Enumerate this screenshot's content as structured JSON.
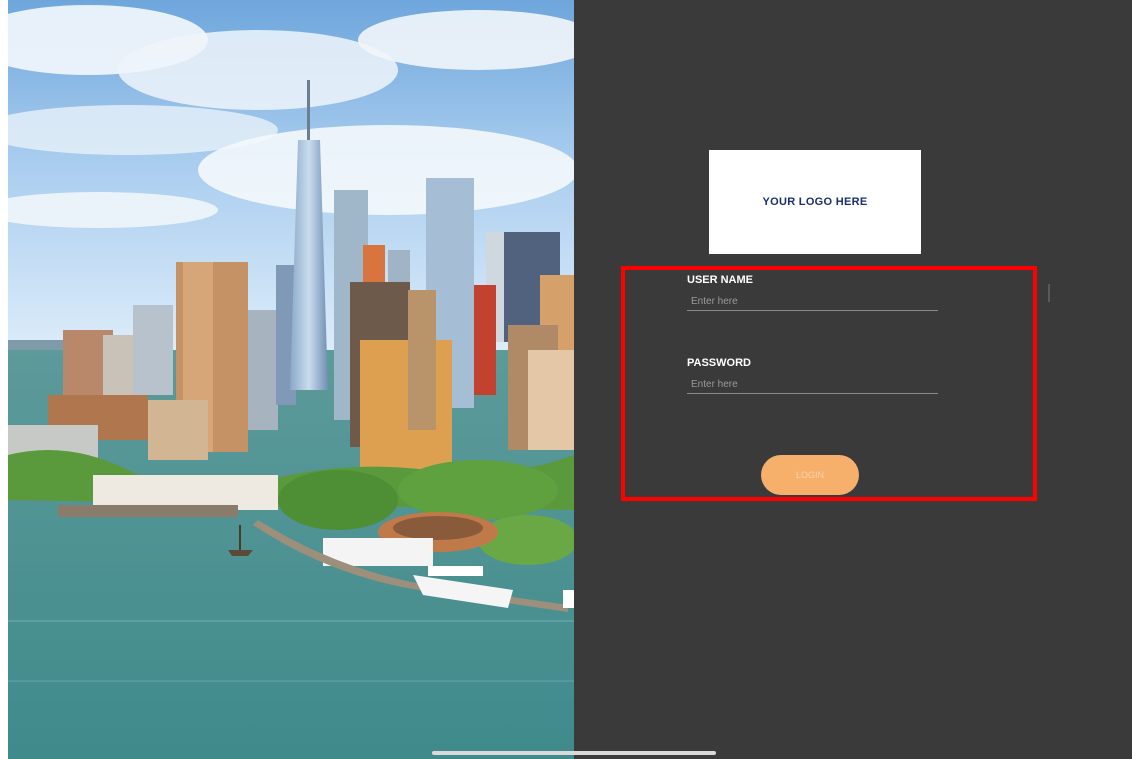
{
  "logo": {
    "text": "YOUR LOGO HERE"
  },
  "form": {
    "username": {
      "label": "USER NAME",
      "placeholder": "Enter here"
    },
    "password": {
      "label": "PASSWORD",
      "placeholder": "Enter here"
    },
    "login_label": "LOGIN"
  },
  "colors": {
    "panel_background": "#3a3a3a",
    "login_button": "#f7b06b",
    "highlight_border": "#ff0000",
    "logo_text": "#1a2f6b"
  }
}
